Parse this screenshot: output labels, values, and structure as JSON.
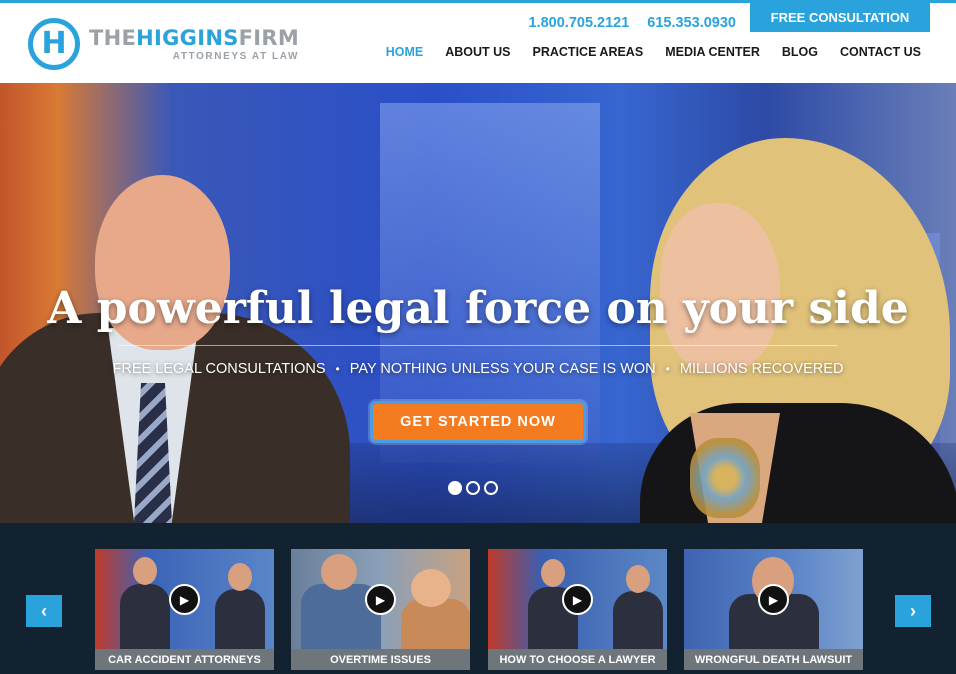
{
  "header": {
    "brand_part1": "THE",
    "brand_part2": "HIGGINS",
    "brand_part3": "FIRM",
    "tagline": "ATTORNEYS AT LAW",
    "logo_letter": "H",
    "phone_1": "1.800.705.2121",
    "phone_2": "615.353.0930",
    "consult_label": "FREE CONSULTATION",
    "nav": [
      {
        "label": "HOME",
        "active": true
      },
      {
        "label": "ABOUT US",
        "active": false
      },
      {
        "label": "PRACTICE AREAS",
        "active": false
      },
      {
        "label": "MEDIA CENTER",
        "active": false
      },
      {
        "label": "BLOG",
        "active": false
      },
      {
        "label": "CONTACT US",
        "active": false
      }
    ]
  },
  "hero": {
    "title": "A powerful legal force on your side",
    "benefits": [
      "FREE LEGAL CONSULTATIONS",
      "PAY NOTHING UNLESS YOUR CASE IS WON",
      "MILLIONS RECOVERED"
    ],
    "separator": "•",
    "cta_label": "GET STARTED NOW",
    "slides_total": 3,
    "slide_active": 1
  },
  "videos": {
    "prev_icon": "chevron-left-icon",
    "next_icon": "chevron-right-icon",
    "items": [
      {
        "caption": "CAR ACCIDENT ATTORNEYS"
      },
      {
        "caption": "OVERTIME ISSUES"
      },
      {
        "caption": "HOW TO CHOOSE A LAWYER"
      },
      {
        "caption": "WRONGFUL DEATH LAWSUIT"
      }
    ]
  },
  "colors": {
    "accent": "#2aa3dc",
    "cta": "#f47b20",
    "strip_bg": "#132230"
  }
}
